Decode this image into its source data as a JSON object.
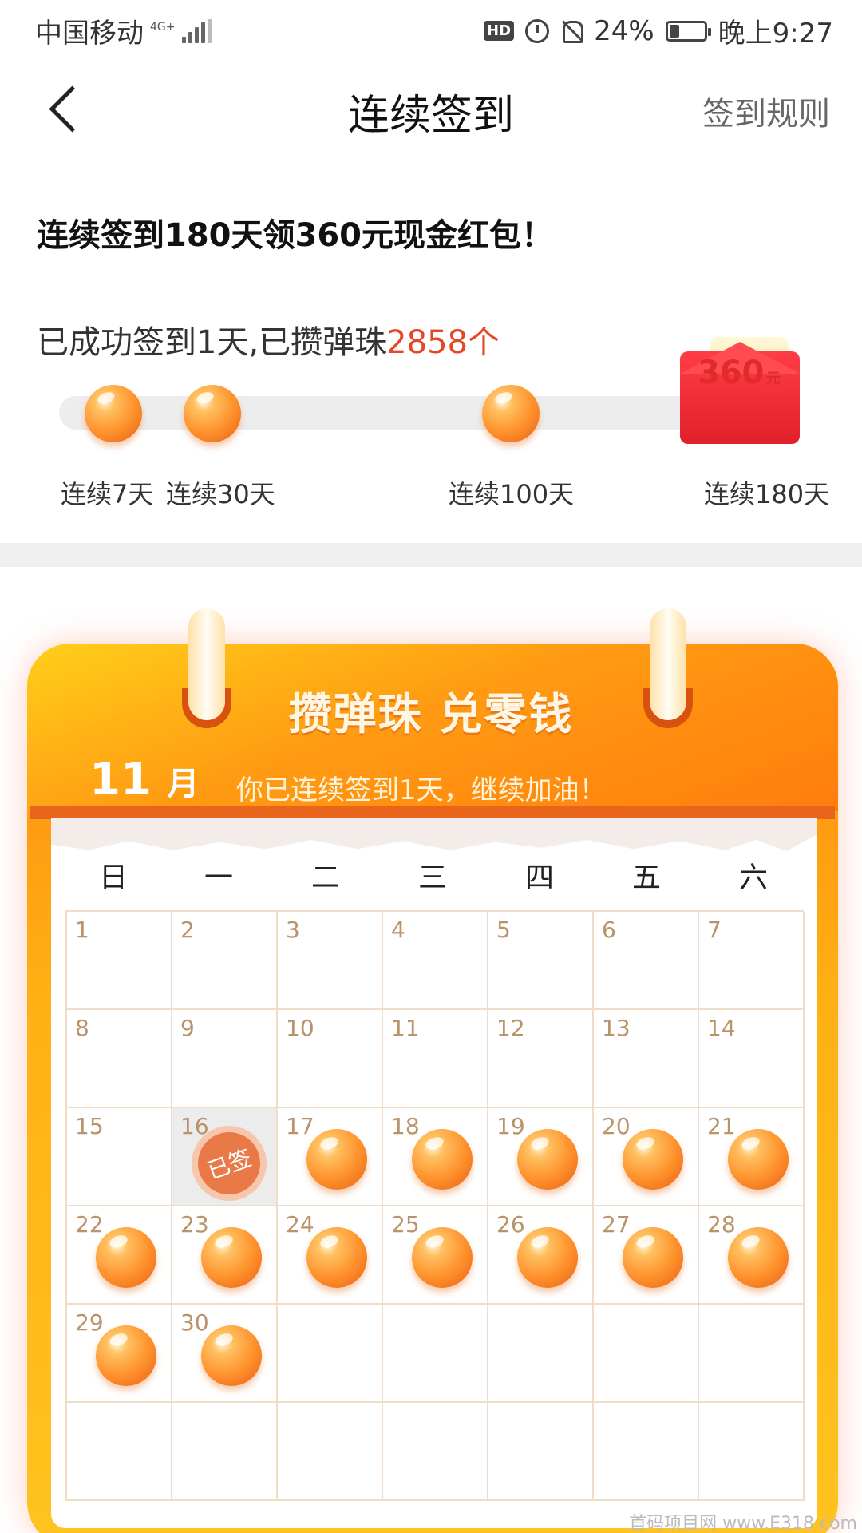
{
  "status_bar": {
    "carrier": "中国移动",
    "network": "4G+",
    "battery": "24%",
    "time": "晚上9:27",
    "hd": "HD"
  },
  "nav": {
    "title": "连续签到",
    "rules": "签到规则"
  },
  "promo": "连续签到180天领360元现金红包！",
  "progress": {
    "prefix": "已成功签到1天,已攒弹珠",
    "count": "2858个"
  },
  "milestones": [
    "连续7天",
    "连续30天",
    "连续100天",
    "连续180天"
  ],
  "envelope": {
    "amount": "360",
    "unit": "元"
  },
  "calendar": {
    "title": "攒弹珠  兑零钱",
    "month_num": "11",
    "month_unit": "月",
    "motto": "你已连续签到1天，继续加油！",
    "weekdays": [
      "日",
      "一",
      "二",
      "三",
      "四",
      "五",
      "六"
    ],
    "days": [
      "1",
      "2",
      "3",
      "4",
      "5",
      "6",
      "7",
      "8",
      "9",
      "10",
      "11",
      "12",
      "13",
      "14",
      "15",
      "16",
      "17",
      "18",
      "19",
      "20",
      "21",
      "22",
      "23",
      "24",
      "25",
      "26",
      "27",
      "28",
      "29",
      "30"
    ],
    "signed_label": "已签"
  },
  "watermark": "首码项目网 www.E318.com"
}
